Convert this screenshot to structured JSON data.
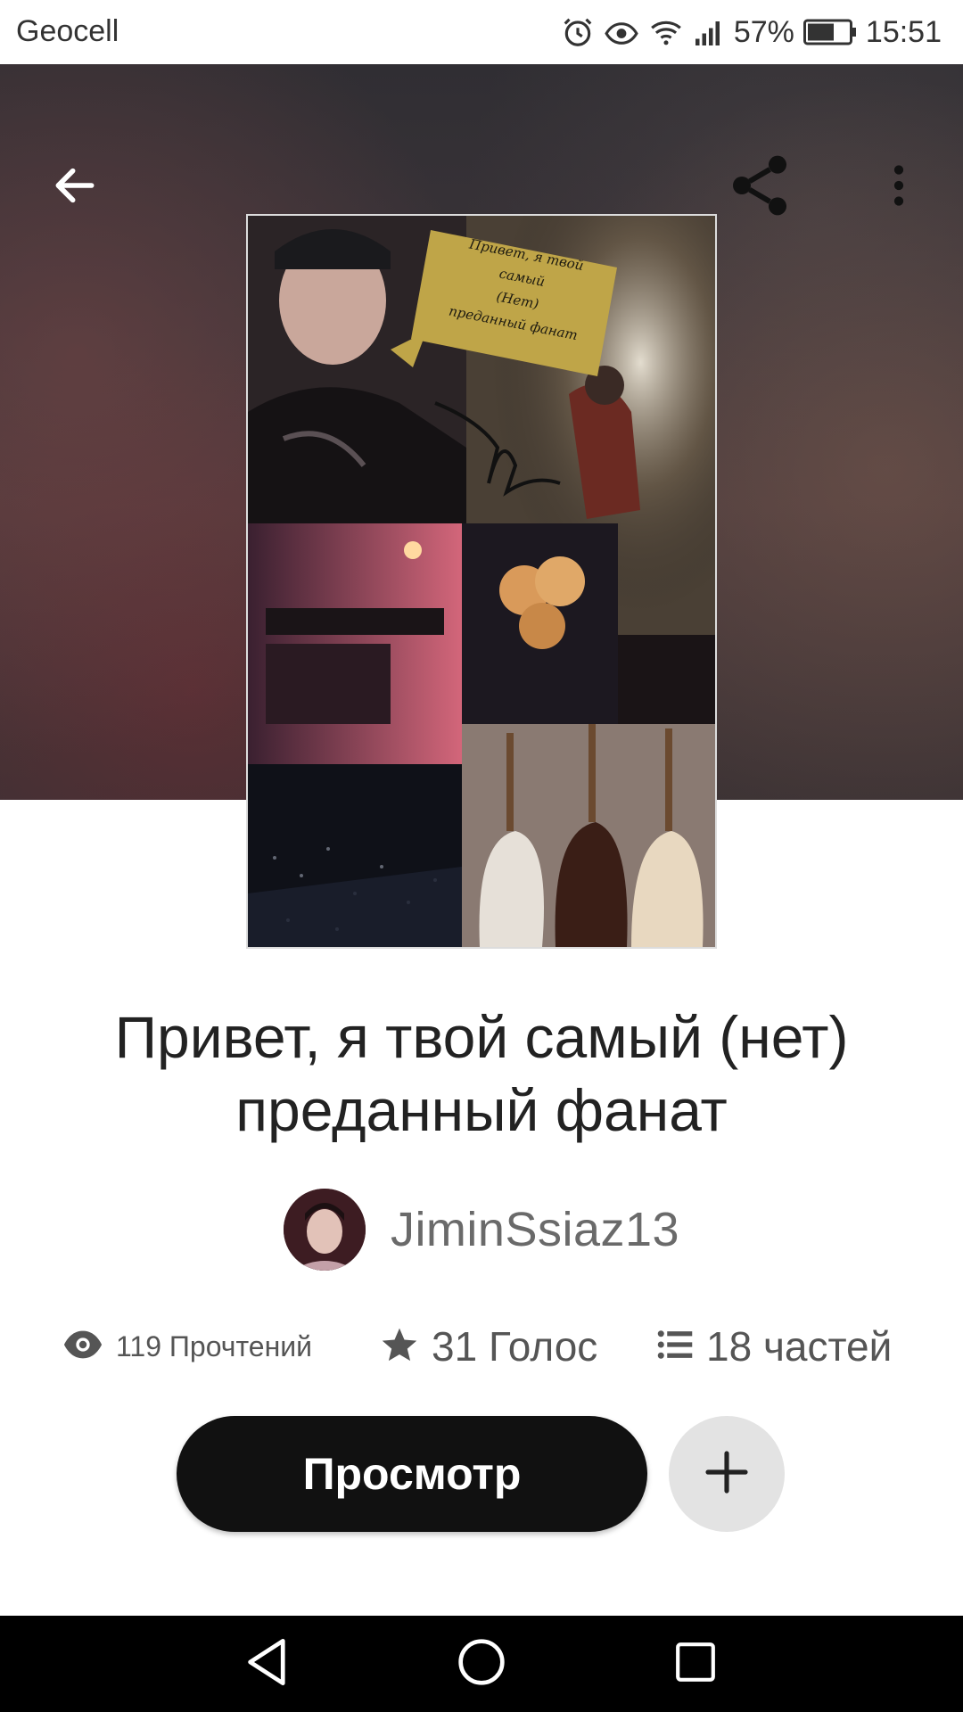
{
  "status_bar": {
    "carrier": "Geocell",
    "battery_percent": "57%",
    "time": "15:51",
    "icons": [
      "alarm-icon",
      "eye-comfort-icon",
      "wifi-icon",
      "signal-icon",
      "battery-icon"
    ]
  },
  "top_bar": {
    "back_icon": "arrow-left-icon",
    "share_icon": "share-icon",
    "more_icon": "more-vert-icon"
  },
  "cover": {
    "note_lines": [
      "Привет, я твой самый",
      "(Нет)",
      "преданный фанат"
    ]
  },
  "story": {
    "title": "Привет, я твой самый (нет) преданный фанат",
    "author": "JiminSsiaz13"
  },
  "stats": {
    "reads": "119 Прочтений",
    "votes": "31 Голос",
    "parts": "18 частей"
  },
  "actions": {
    "read_label": "Просмотр",
    "add_icon": "plus-icon"
  },
  "nav_bar": {
    "icons": [
      "back-triangle-icon",
      "home-circle-icon",
      "recents-square-icon"
    ]
  },
  "colors": {
    "primary_button": "#111111",
    "secondary_button": "#e3e3e3",
    "text_main": "#222222",
    "text_muted": "#555555"
  }
}
